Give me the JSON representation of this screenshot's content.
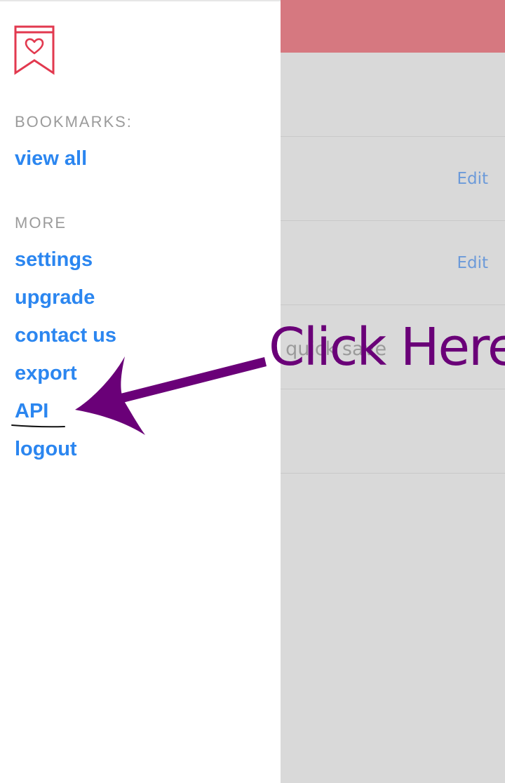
{
  "drawer": {
    "sections": {
      "bookmarks_heading": "BOOKMARKS:",
      "more_heading": "MORE"
    },
    "links": {
      "view_all": "view all",
      "settings": "settings",
      "upgrade": "upgrade",
      "contact_us": "contact us",
      "export": "export",
      "api": "API",
      "logout": "logout"
    }
  },
  "background_app": {
    "rows": [
      {
        "edit_label": "Edit"
      },
      {
        "edit_label": "Edit"
      }
    ],
    "quick_save_fragment": "o quick save"
  },
  "annotation": {
    "text": "Click Here",
    "color": "#6a0078"
  },
  "colors": {
    "link": "#2b86f0",
    "header_accent": "#d67880",
    "logo": "#e2394f",
    "heading_gray": "#9b9b9b"
  }
}
